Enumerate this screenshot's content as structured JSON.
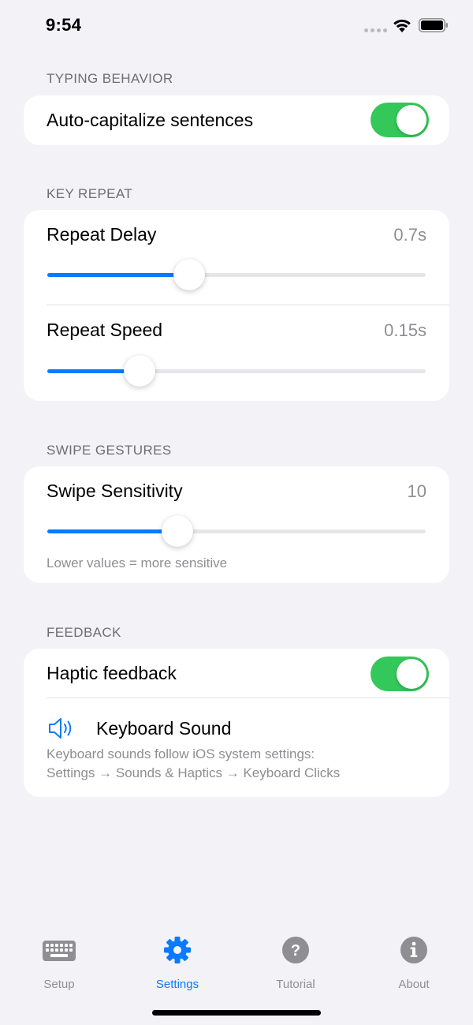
{
  "status_bar": {
    "time": "9:54"
  },
  "sections": {
    "typing": {
      "header": "TYPING BEHAVIOR",
      "auto_capitalize": {
        "label": "Auto-capitalize sentences",
        "enabled": true
      }
    },
    "key_repeat": {
      "header": "KEY REPEAT",
      "repeat_delay": {
        "label": "Repeat Delay",
        "value": "0.7s",
        "level_fraction": 0.375
      },
      "repeat_speed": {
        "label": "Repeat Speed",
        "value": "0.15s",
        "level_fraction": 0.244
      }
    },
    "swipe": {
      "header": "SWIPE GESTURES",
      "swipe_sensitivity": {
        "label": "Swipe Sensitivity",
        "value": "10",
        "level_fraction": 0.344
      },
      "note": "Lower values = more sensitive"
    },
    "feedback": {
      "header": "FEEDBACK",
      "haptic": {
        "label": "Haptic feedback",
        "enabled": true
      },
      "keyboard_sound": {
        "label": "Keyboard Sound",
        "icon": "speaker-icon",
        "note_line1": "Keyboard sounds follow iOS system settings:",
        "note_line2": "Settings → Sounds & Haptics → Keyboard Clicks"
      }
    }
  },
  "tab_bar": {
    "tabs": [
      {
        "label": "Setup",
        "icon": "keyboard-icon",
        "active": false
      },
      {
        "label": "Settings",
        "icon": "gear-icon",
        "active": true
      },
      {
        "label": "Tutorial",
        "icon": "question-icon",
        "active": false
      },
      {
        "label": "About",
        "icon": "info-icon",
        "active": false
      }
    ]
  },
  "colors": {
    "accent": "#0a7aff",
    "toggle_on": "#34c759",
    "background": "#f2f2f7",
    "secondary_text": "#8e8e93"
  }
}
